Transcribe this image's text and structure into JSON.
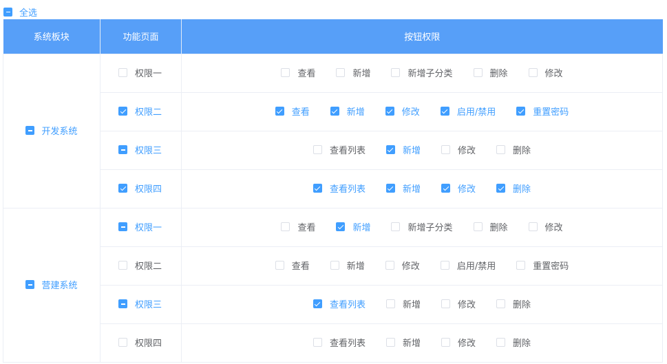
{
  "select_all": {
    "label": "全选",
    "state": "indeterminate"
  },
  "columns": [
    "系统板块",
    "功能页面",
    "按钮权限"
  ],
  "systems": [
    {
      "name": "开发系统",
      "state": "indeterminate",
      "pages": [
        {
          "name": "权限一",
          "state": "unchecked",
          "buttons": [
            {
              "label": "查看",
              "checked": false
            },
            {
              "label": "新增",
              "checked": false
            },
            {
              "label": "新增子分类",
              "checked": false
            },
            {
              "label": "删除",
              "checked": false
            },
            {
              "label": "修改",
              "checked": false
            }
          ]
        },
        {
          "name": "权限二",
          "state": "checked",
          "buttons": [
            {
              "label": "查看",
              "checked": true
            },
            {
              "label": "新增",
              "checked": true
            },
            {
              "label": "修改",
              "checked": true
            },
            {
              "label": "启用/禁用",
              "checked": true
            },
            {
              "label": "重置密码",
              "checked": true
            }
          ]
        },
        {
          "name": "权限三",
          "state": "indeterminate",
          "buttons": [
            {
              "label": "查看列表",
              "checked": false
            },
            {
              "label": "新增",
              "checked": true
            },
            {
              "label": "修改",
              "checked": false
            },
            {
              "label": "删除",
              "checked": false
            }
          ]
        },
        {
          "name": "权限四",
          "state": "checked",
          "buttons": [
            {
              "label": "查看列表",
              "checked": true
            },
            {
              "label": "新增",
              "checked": true
            },
            {
              "label": "修改",
              "checked": true
            },
            {
              "label": "删除",
              "checked": true
            }
          ]
        }
      ]
    },
    {
      "name": "营建系统",
      "state": "indeterminate",
      "pages": [
        {
          "name": "权限一",
          "state": "indeterminate",
          "buttons": [
            {
              "label": "查看",
              "checked": false
            },
            {
              "label": "新增",
              "checked": true
            },
            {
              "label": "新增子分类",
              "checked": false
            },
            {
              "label": "删除",
              "checked": false
            },
            {
              "label": "修改",
              "checked": false
            }
          ]
        },
        {
          "name": "权限二",
          "state": "unchecked",
          "buttons": [
            {
              "label": "查看",
              "checked": false
            },
            {
              "label": "新增",
              "checked": false
            },
            {
              "label": "修改",
              "checked": false
            },
            {
              "label": "启用/禁用",
              "checked": false
            },
            {
              "label": "重置密码",
              "checked": false
            }
          ]
        },
        {
          "name": "权限三",
          "state": "indeterminate",
          "buttons": [
            {
              "label": "查看列表",
              "checked": true
            },
            {
              "label": "新增",
              "checked": false
            },
            {
              "label": "修改",
              "checked": false
            },
            {
              "label": "删除",
              "checked": false
            }
          ]
        },
        {
          "name": "权限四",
          "state": "unchecked",
          "buttons": [
            {
              "label": "查看列表",
              "checked": false
            },
            {
              "label": "新增",
              "checked": false
            },
            {
              "label": "修改",
              "checked": false
            },
            {
              "label": "删除",
              "checked": false
            }
          ]
        }
      ]
    }
  ],
  "colors": {
    "accent": "#409eff",
    "header_bg": "#579ff8",
    "border": "#ebeef5",
    "text": "#606266"
  }
}
